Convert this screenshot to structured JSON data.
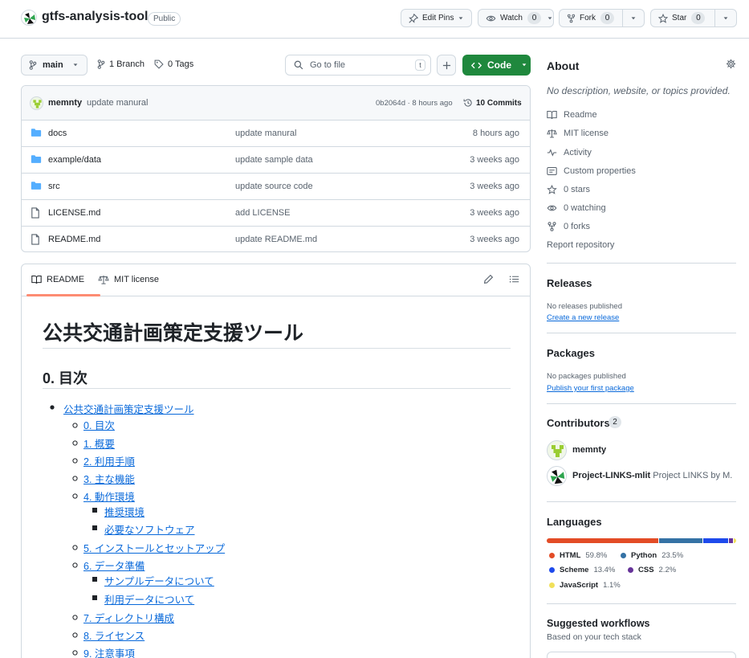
{
  "header": {
    "repo_name": "gtfs-analysis-tool",
    "visibility": "Public",
    "edit_pins": "Edit Pins",
    "watch": "Watch",
    "watch_count": "0",
    "fork": "Fork",
    "fork_count": "0",
    "star": "Star",
    "star_count": "0"
  },
  "controls": {
    "branch": "main",
    "branches": "1 Branch",
    "tags": "0 Tags",
    "goto_placeholder": "Go to file",
    "goto_key": "t",
    "code": "Code"
  },
  "commit": {
    "author": "memnty",
    "message": "update manural",
    "hash_time": "0b2064d · 8 hours ago",
    "commits": "10 Commits"
  },
  "files": [
    {
      "name": "docs",
      "type": "folder",
      "message": "update manural",
      "time": "8 hours ago"
    },
    {
      "name": "example/data",
      "type": "folder",
      "message": "update sample data",
      "time": "3 weeks ago"
    },
    {
      "name": "src",
      "type": "folder",
      "message": "update source code",
      "time": "3 weeks ago"
    },
    {
      "name": "LICENSE.md",
      "type": "file",
      "message": "add LICENSE",
      "time": "3 weeks ago"
    },
    {
      "name": "README.md",
      "type": "file",
      "message": "update README.md",
      "time": "3 weeks ago"
    }
  ],
  "readme": {
    "tab_readme": "README",
    "tab_license": "MIT license",
    "h1": "公共交通計画策定支援ツール",
    "h2": "0. 目次",
    "toc": [
      {
        "label": "公共交通計画策定支援ツール",
        "level": 1
      },
      {
        "label": "0. 目次",
        "level": 2
      },
      {
        "label": "1. 概要",
        "level": 2
      },
      {
        "label": "2. 利用手順",
        "level": 2
      },
      {
        "label": "3. 主な機能",
        "level": 2
      },
      {
        "label": "4. 動作環境",
        "level": 2
      },
      {
        "label": "推奨環境",
        "level": 3
      },
      {
        "label": "必要なソフトウェア",
        "level": 3
      },
      {
        "label": "5. インストールとセットアップ",
        "level": 2
      },
      {
        "label": "6. データ準備",
        "level": 2
      },
      {
        "label": "サンプルデータについて",
        "level": 3
      },
      {
        "label": "利用データについて",
        "level": 3
      },
      {
        "label": "7. ディレクトリ構成",
        "level": 2
      },
      {
        "label": "8. ライセンス",
        "level": 2
      },
      {
        "label": "9. 注意事項",
        "level": 2
      }
    ]
  },
  "sidebar": {
    "about_title": "About",
    "about_desc": "No description, website, or topics provided.",
    "links": [
      {
        "label": "Readme",
        "icon": "book-icon"
      },
      {
        "label": "MIT license",
        "icon": "law-icon"
      },
      {
        "label": "Activity",
        "icon": "pulse-icon"
      },
      {
        "label": "Custom properties",
        "icon": "note-icon"
      },
      {
        "label": "0 stars",
        "icon": "star-icon"
      },
      {
        "label": "0 watching",
        "icon": "eye-icon"
      },
      {
        "label": "0 forks",
        "icon": "fork-icon"
      }
    ],
    "report": "Report repository",
    "releases_title": "Releases",
    "releases_none": "No releases published",
    "releases_link": "Create a new release",
    "packages_title": "Packages",
    "packages_none": "No packages published",
    "packages_link": "Publish your first package",
    "contributors_title": "Contributors",
    "contributors_count": "2",
    "contributors": [
      {
        "name": "memnty",
        "desc": ""
      },
      {
        "name": "Project-LINKS-mlit",
        "desc": "Project LINKS by M..."
      }
    ],
    "languages_title": "Languages",
    "languages": [
      {
        "name": "HTML",
        "percent": "59.8%",
        "value": 59.8,
        "color": "#e34c26"
      },
      {
        "name": "Python",
        "percent": "23.5%",
        "value": 23.5,
        "color": "#3572A5"
      },
      {
        "name": "Scheme",
        "percent": "13.4%",
        "value": 13.4,
        "color": "#1e4aec"
      },
      {
        "name": "CSS",
        "percent": "2.2%",
        "value": 2.2,
        "color": "#663399"
      },
      {
        "name": "JavaScript",
        "percent": "1.1%",
        "value": 1.1,
        "color": "#f1e05a"
      }
    ],
    "workflows_title": "Suggested workflows",
    "workflows_sub": "Based on your tech stack"
  }
}
